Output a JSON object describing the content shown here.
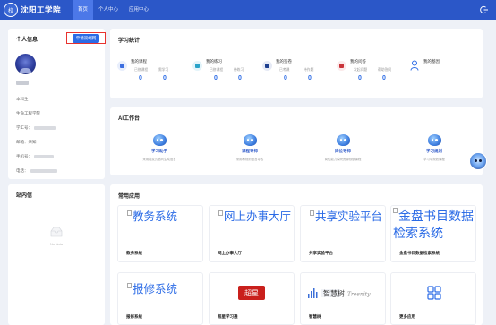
{
  "header": {
    "logo_text": "沈阳工学院",
    "nav": [
      {
        "label": "首页",
        "active": true
      },
      {
        "label": "个人中心",
        "active": false
      },
      {
        "label": "应用中心",
        "active": false
      }
    ]
  },
  "profile": {
    "title": "个人信息",
    "apply_button": "申请双端网",
    "level": "本科生",
    "college": "生命工程学院",
    "student_id_label": "学工号：",
    "email_label": "邮箱：",
    "email_value": "未知",
    "phone_label": "手机号：",
    "tel_label": "电话："
  },
  "mailbox": {
    "title": "站内信",
    "empty": "No data"
  },
  "stats": {
    "title": "学习统计",
    "groups": [
      {
        "name": "我的课程",
        "subs": [
          {
            "label": "已修课程",
            "value": "0"
          },
          {
            "label": "需学习",
            "value": "0"
          }
        ],
        "color": "#3d6fe0"
      },
      {
        "name": "我的练习",
        "subs": [
          {
            "label": "已修课程",
            "value": "0"
          },
          {
            "label": "待练习",
            "value": "0"
          }
        ],
        "color": "#2aa3c9"
      },
      {
        "name": "我的签卷",
        "subs": [
          {
            "label": "已考课",
            "value": "0"
          },
          {
            "label": "待作题",
            "value": "0"
          }
        ],
        "color": "#1e3f8f"
      },
      {
        "name": "我的问答",
        "subs": [
          {
            "label": "发起问题",
            "value": "0"
          },
          {
            "label": "帮助答同",
            "value": "0"
          }
        ],
        "color": "#c9343a"
      }
    ],
    "gene_label": "我的基因"
  },
  "ai": {
    "title": "AI工作台",
    "items": [
      {
        "name": "学习助手",
        "desc": "采用能发式追问生成语言"
      },
      {
        "name": "课程导师",
        "desc": "采用和规则语言导答"
      },
      {
        "name": "岗位导师",
        "desc": "岗位能力模块资源领航课程"
      },
      {
        "name": "学习规划",
        "desc": "学习中规划课程"
      }
    ]
  },
  "apps": {
    "title": "常用应用",
    "items": [
      {
        "img_alt": "教务系统",
        "label": "教务系统"
      },
      {
        "img_alt": "网上办事大厅",
        "label": "网上办事大厅"
      },
      {
        "img_alt": "共享实验平台",
        "label": "共享实验平台"
      },
      {
        "img_alt": "金盘书目数据检索系统",
        "label": "金盘书目数据检索系统"
      },
      {
        "img_alt": "报修系统",
        "label": "报修系统"
      },
      {
        "img_alt": "超星",
        "label": "超星学习通"
      },
      {
        "img_alt": "智慧树",
        "label": "智慧树"
      },
      {
        "img_alt": "",
        "label": "更多应用"
      }
    ]
  },
  "colors": {
    "brand": "#2b57c8",
    "accent": "#2b6be6",
    "highlight_border": "#e8322e"
  }
}
